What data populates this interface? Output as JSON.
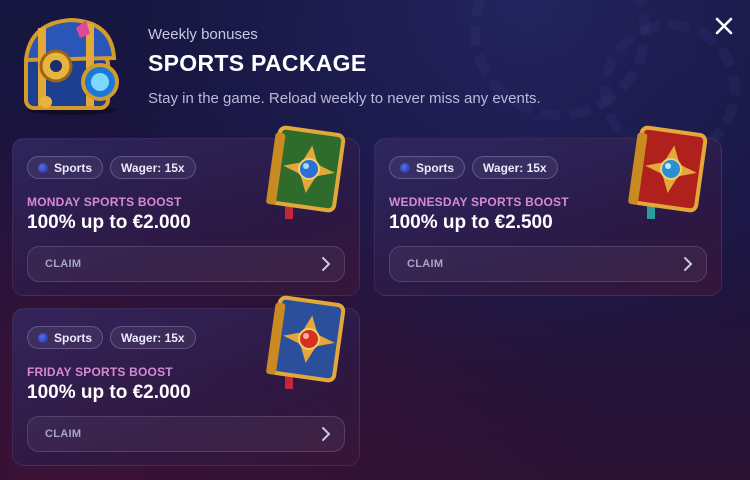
{
  "header": {
    "subtitle": "Weekly bonuses",
    "title": "SPORTS PACKAGE",
    "description": "Stay in the game. Reload weekly to never miss any events.",
    "chest_icon": "treasure-chest-icon",
    "close_icon": "close-icon"
  },
  "cards": [
    {
      "tags": [
        {
          "label": "Sports",
          "icon": "sports-ball-icon"
        },
        {
          "label": "Wager: 15x"
        }
      ],
      "label": "MONDAY SPORTS BOOST",
      "amount": "100% up to €2.000",
      "claim": "CLAIM",
      "book_icon": "green-spell-book-icon",
      "book_cover": "#2f6b2a",
      "book_gem": "#2a6fd6"
    },
    {
      "tags": [
        {
          "label": "Sports",
          "icon": "sports-ball-icon"
        },
        {
          "label": "Wager: 15x"
        }
      ],
      "label": "WEDNESDAY SPORTS BOOST",
      "amount": "100% up to €2.500",
      "claim": "CLAIM",
      "book_icon": "red-spell-book-icon",
      "book_cover": "#b0211d",
      "book_gem": "#2a8fd6"
    },
    {
      "tags": [
        {
          "label": "Sports",
          "icon": "sports-ball-icon"
        },
        {
          "label": "Wager: 15x"
        }
      ],
      "label": "FRIDAY SPORTS BOOST",
      "amount": "100% up to €2.000",
      "claim": "CLAIM",
      "book_icon": "blue-spell-book-icon",
      "book_cover": "#2b4f9a",
      "book_gem": "#d83020"
    }
  ],
  "colors": {
    "accent_label": "#d78ad3",
    "background": "#17163f"
  }
}
